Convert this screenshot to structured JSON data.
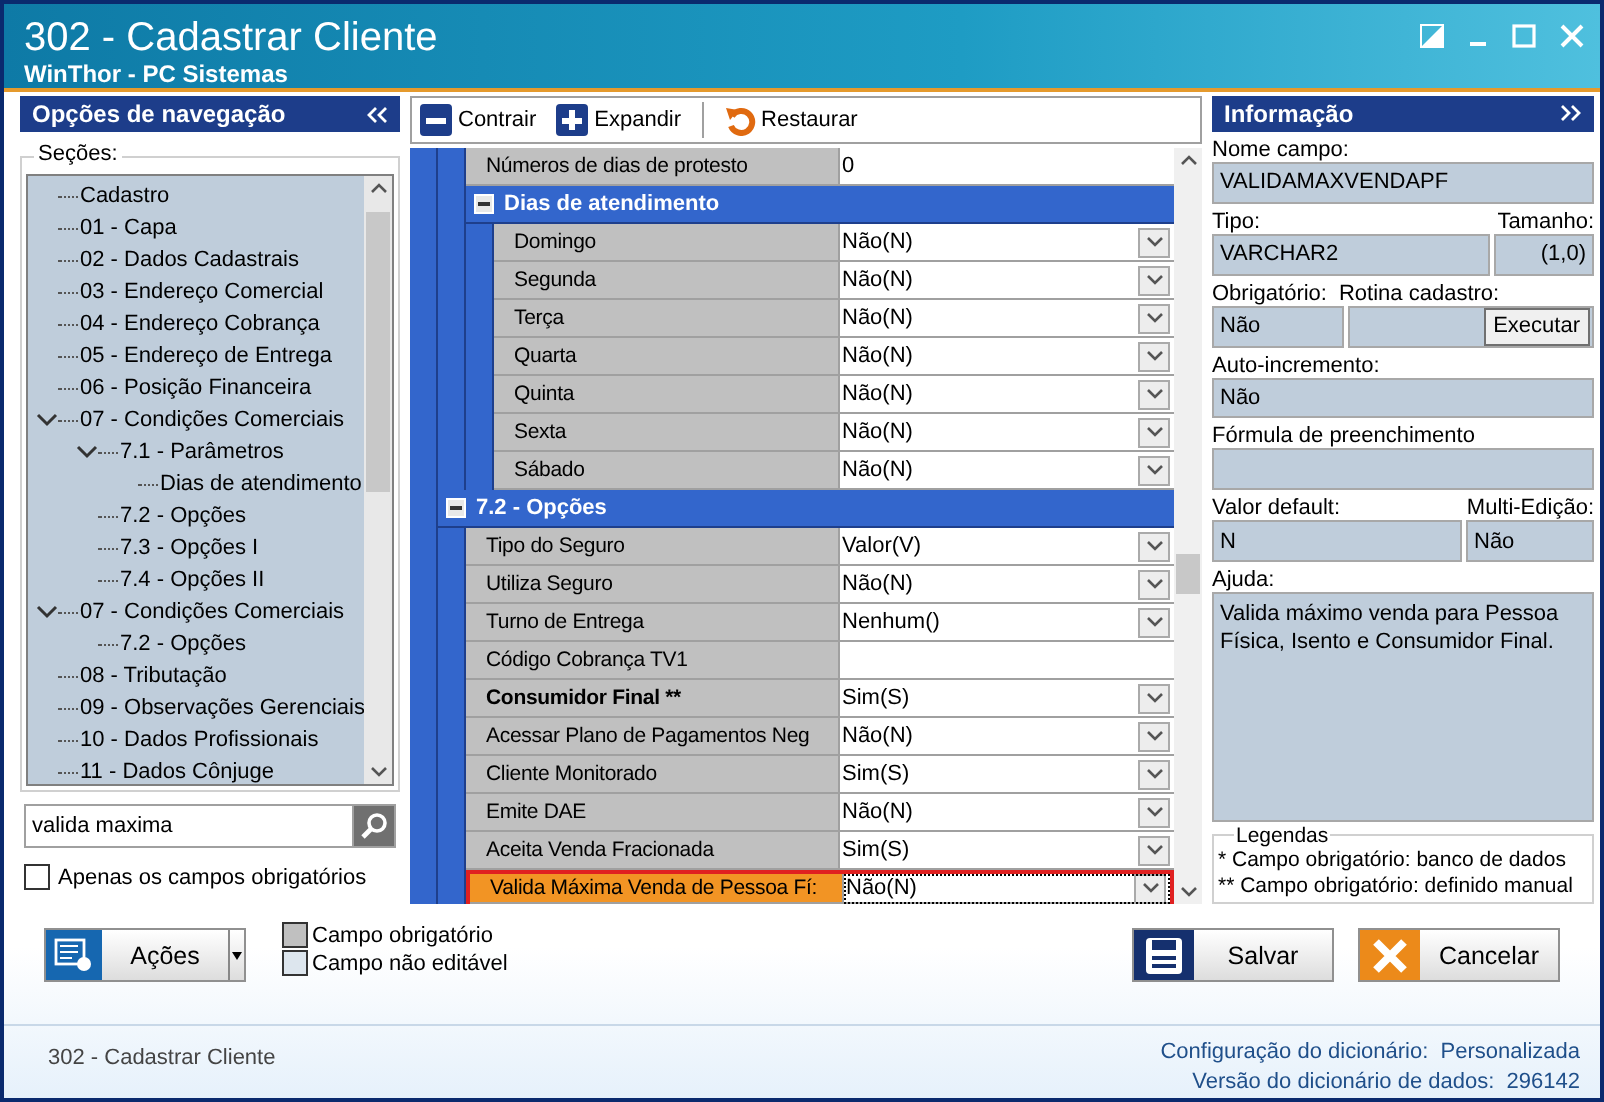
{
  "window": {
    "title": "302 - Cadastrar Cliente",
    "subtitle": "WinThor - PC Sistemas"
  },
  "navigation": {
    "title": "Opções de navegação",
    "sections_label": "Seções:",
    "tree": [
      {
        "label": "Cadastro"
      },
      {
        "label": "01 - Capa"
      },
      {
        "label": "02 - Dados Cadastrais"
      },
      {
        "label": "03 - Endereço Comercial"
      },
      {
        "label": "04 - Endereço Cobrança"
      },
      {
        "label": "05 - Endereço de Entrega"
      },
      {
        "label": "06 - Posição Financeira"
      },
      {
        "label": "07 - Condições Comerciais",
        "expanded": true,
        "children": [
          {
            "label": "7.1 - Parâmetros",
            "expanded": true,
            "children": [
              {
                "label": "Dias de atendimento"
              }
            ]
          },
          {
            "label": "7.2 - Opções"
          },
          {
            "label": "7.3 - Opções I"
          },
          {
            "label": "7.4 - Opções II"
          }
        ]
      },
      {
        "label": "07 - Condições Comerciais",
        "expanded": true,
        "children": [
          {
            "label": "7.2 - Opções"
          }
        ]
      },
      {
        "label": "08 - Tributação"
      },
      {
        "label": "09 - Observações Gerenciais"
      },
      {
        "label": "10 - Dados Profissionais"
      },
      {
        "label": "11 - Dados Cônjuge"
      }
    ],
    "search": {
      "value": "valida maxima"
    },
    "only_required": {
      "label": "Apenas os campos obrigatórios",
      "checked": false
    }
  },
  "toolbar": [
    {
      "label": "Contrair",
      "kind": "collapse"
    },
    {
      "label": "Expandir",
      "kind": "expand"
    },
    {
      "label": "Restaurar",
      "kind": "restore"
    }
  ],
  "grid": {
    "sections": [
      {
        "rows": [
          {
            "label": "Números de dias de protesto",
            "value": "0",
            "kind": "text",
            "bold": false,
            "selected": false
          }
        ],
        "subsections": [
          {
            "title": "Dias de atendimento",
            "expanded": true,
            "rows": [
              {
                "label": "Domingo",
                "value": "Não(N)",
                "kind": "dropdown",
                "bold": false,
                "selected": false
              },
              {
                "label": "Segunda",
                "value": "Não(N)",
                "kind": "dropdown",
                "bold": false,
                "selected": false
              },
              {
                "label": "Terça",
                "value": "Não(N)",
                "kind": "dropdown",
                "bold": false,
                "selected": false
              },
              {
                "label": "Quarta",
                "value": "Não(N)",
                "kind": "dropdown",
                "bold": false,
                "selected": false
              },
              {
                "label": "Quinta",
                "value": "Não(N)",
                "kind": "dropdown",
                "bold": false,
                "selected": false
              },
              {
                "label": "Sexta",
                "value": "Não(N)",
                "kind": "dropdown",
                "bold": false,
                "selected": false
              },
              {
                "label": "Sábado",
                "value": "Não(N)",
                "kind": "dropdown",
                "bold": false,
                "selected": false
              }
            ]
          }
        ]
      },
      {
        "title": "7.2 - Opções",
        "expanded": true,
        "rows": [
          {
            "label": "Tipo do Seguro",
            "value": "Valor(V)",
            "kind": "dropdown",
            "bold": false,
            "selected": false
          },
          {
            "label": "Utiliza Seguro",
            "value": "Não(N)",
            "kind": "dropdown",
            "bold": false,
            "selected": false
          },
          {
            "label": "Turno de Entrega",
            "value": "Nenhum()",
            "kind": "dropdown",
            "bold": false,
            "selected": false
          },
          {
            "label": "Código Cobrança TV1",
            "kind": "text",
            "bold": false,
            "selected": false
          },
          {
            "label": "Consumidor Final **",
            "value": "Sim(S)",
            "kind": "dropdown",
            "bold": true,
            "selected": false
          },
          {
            "label": "Acessar Plano de Pagamentos Neg",
            "value": "Não(N)",
            "kind": "dropdown",
            "bold": false,
            "selected": false
          },
          {
            "label": "Cliente Monitorado",
            "value": "Sim(S)",
            "kind": "dropdown",
            "bold": false,
            "selected": false
          },
          {
            "label": "Emite DAE",
            "value": "Não(N)",
            "kind": "dropdown",
            "bold": false,
            "selected": false
          },
          {
            "label": "Aceita Venda Fracionada",
            "value": "Sim(S)",
            "kind": "dropdown",
            "bold": false,
            "selected": false
          },
          {
            "label": "Valida Máxima Venda de Pessoa Fí:",
            "value": "Não(N)",
            "kind": "dropdown",
            "bold": false,
            "selected": true
          }
        ]
      }
    ]
  },
  "info": {
    "title": "Informação",
    "field_name": {
      "label": "Nome campo:",
      "value": "VALIDAMAXVENDAPF"
    },
    "type": {
      "label": "Tipo:",
      "value": "VARCHAR2"
    },
    "size": {
      "label": "Tamanho:",
      "value": "(1,0)"
    },
    "required": {
      "label": "Obrigatório:",
      "value": "Não"
    },
    "routine": {
      "label": "Rotina cadastro:",
      "button": "Executar"
    },
    "auto_increment": {
      "label": "Auto-incremento:",
      "value": "Não"
    },
    "formula": {
      "label": "Fórmula de preenchimento"
    },
    "default_value": {
      "label": "Valor default:",
      "value": "N"
    },
    "multi_edit": {
      "label": "Multi-Edição:",
      "value": "Não"
    },
    "help": {
      "label": "Ajuda:",
      "value": "Valida máximo venda para Pessoa Física, Isento e Consumidor Final."
    },
    "legend": {
      "title": "Legendas",
      "lines": [
        "* Campo obrigatório: banco de dados",
        "** Campo obrigatório: definido manual"
      ]
    }
  },
  "actions_button": "Ações",
  "legend_keys": [
    {
      "label": "Campo obrigatório",
      "kind": "required"
    },
    {
      "label": "Campo não editável",
      "kind": "readonly"
    }
  ],
  "buttons": [
    {
      "label": "Salvar",
      "kind": "save"
    },
    {
      "label": "Cancelar",
      "kind": "cancel"
    }
  ],
  "status_bar": {
    "left": "302 - Cadastrar Cliente",
    "lines": [
      {
        "label": "Configuração do dicionário:",
        "value": "Personalizada"
      },
      {
        "label": "Versão do dicionário de dados:",
        "value": "296142"
      }
    ]
  }
}
